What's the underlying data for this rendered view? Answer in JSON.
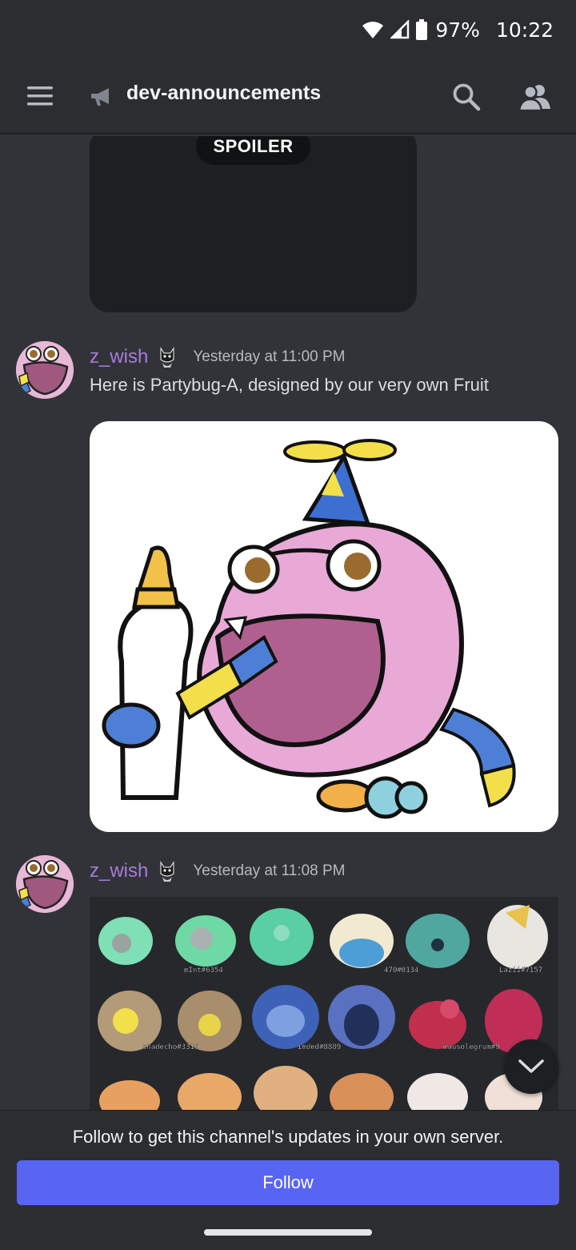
{
  "status_bar": {
    "battery": "97%",
    "time": "10:22"
  },
  "header": {
    "channel_name": "dev-announcements"
  },
  "spoiler": {
    "label": "SPOILER"
  },
  "messages": [
    {
      "author": "z_wish",
      "timestamp": "Yesterday at 11:00 PM",
      "text": "Here is Partybug-A, designed by our very own Fruit"
    },
    {
      "author": "z_wish",
      "timestamp": "Yesterday at 11:08 PM",
      "collage_tags": [
        "mInt#6354",
        "470#0134",
        "Lazii#7157",
        "shadecho#3310",
        "imded#8889",
        "mausolegrum#9"
      ]
    }
  ],
  "footer": {
    "prompt": "Follow to get this channel's updates in your own server.",
    "follow_label": "Follow"
  },
  "colors": {
    "accent": "#5865f2",
    "username": "#a77bd9",
    "background": "#313338"
  }
}
